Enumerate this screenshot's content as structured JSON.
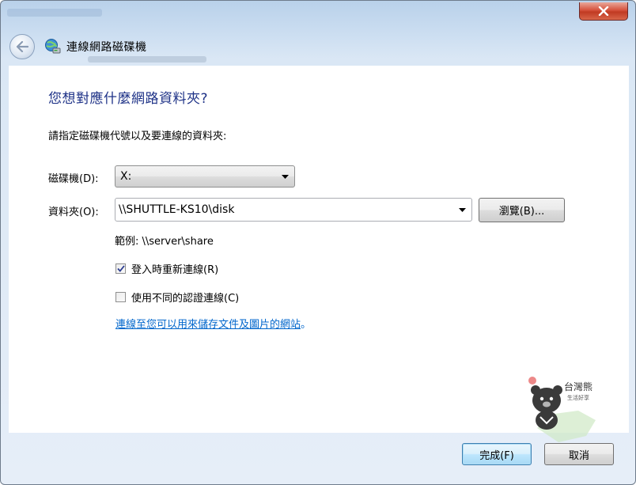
{
  "window": {
    "title": "連線網路磁碟機",
    "close_icon": "close-icon"
  },
  "header": {
    "back_icon": "back-arrow-icon",
    "app_icon": "network-drive-icon"
  },
  "main": {
    "heading": "您想對應什麼網路資料夾?",
    "instruction": "請指定磁碟機代號以及要連線的資料夾:",
    "drive_label": "磁碟機(D):",
    "drive_value": "X:",
    "folder_label": "資料夾(O):",
    "folder_value": "\\\\SHUTTLE-KS10\\disk",
    "browse_label": "瀏覽(B)...",
    "example_text": "範例: \\\\server\\share",
    "reconnect_label": "登入時重新連線(R)",
    "reconnect_checked": true,
    "different_creds_label": "使用不同的認證連線(C)",
    "different_creds_checked": false,
    "link_text": "連線至您可以用來儲存文件及圖片的網站",
    "link_suffix": "。"
  },
  "footer": {
    "finish_label": "完成(F)",
    "cancel_label": "取消"
  },
  "watermark": {
    "text": "台灣熊",
    "subtext": "生活好享"
  },
  "colors": {
    "heading": "#1e3287",
    "link": "#0066cc",
    "title_gradient_top": "#b9d1ea",
    "close_red": "#c13a22"
  }
}
